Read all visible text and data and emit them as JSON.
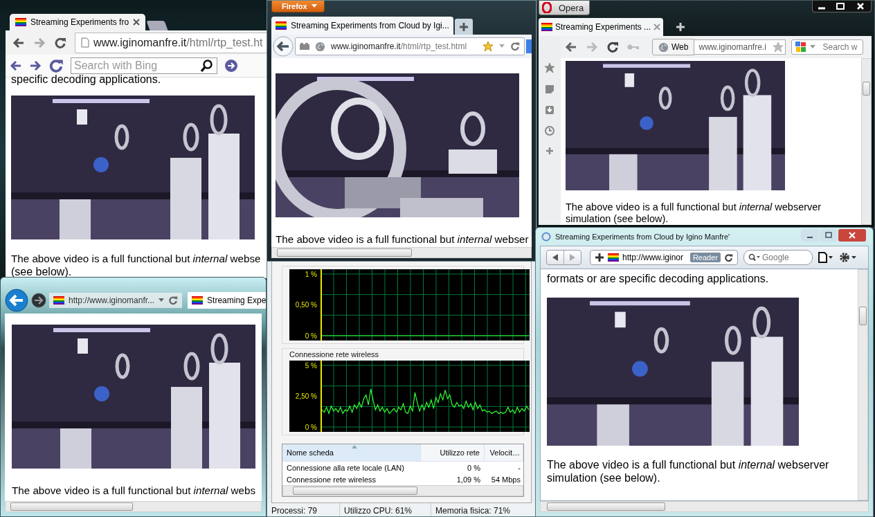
{
  "chrome_window": {
    "tab": {
      "title": "Streaming Experiments fro",
      "selected": true
    },
    "url": {
      "host": "www.iginomanfre.it",
      "path": "/html/rtp_test.ht"
    },
    "search": {
      "placeholder": "Search with Bing"
    },
    "page": {
      "intro": "specific decoding applications.",
      "caption": "The above video is a full functional but *internal* webse",
      "note": "(see below)."
    }
  },
  "firefox_window": {
    "menu_button": "Firefox",
    "tab": {
      "title": "Streaming Experiments from Cloud by Igi...",
      "selected": true
    },
    "url": {
      "host": "www.iginomanfre.it",
      "path": "/html/rtp_test.html"
    },
    "bookmarked": true,
    "page": {
      "caption": "The above video is a full functional but *internal* webser"
    }
  },
  "opera_window": {
    "menu_button": "Opera",
    "tab": {
      "title": "Streaming Experiments ...",
      "selected": true
    },
    "search_engine": "Web",
    "url": "www.iginomanfre.i",
    "search": {
      "placeholder": "Search w"
    },
    "page": {
      "caption": "The above video is a full functional but *internal* webserver simulation (see below)."
    }
  },
  "ie_window": {
    "url": "http://www.iginomanfr...",
    "tab": {
      "title": "Streaming Expe",
      "selected": true
    },
    "page": {
      "caption": "The above video is a full functional but *internal* webs"
    }
  },
  "safari_window": {
    "title": "Streaming Experiments from Cloud by Igino Manfre'",
    "url": "http://www.iginor",
    "reader_badge": "Reader",
    "search": {
      "placeholder": "Google"
    },
    "page": {
      "intro": "formats or are specific decoding applications.",
      "caption": "The above video is a full functional but *internal* webserver simulation (see below)."
    }
  },
  "task_manager": {
    "graphs": [
      {
        "chart_data": {
          "type": "line",
          "grid": true,
          "ylim": [
            0,
            1
          ],
          "yticks": [
            {
              "value": 0,
              "label": "0 %"
            },
            {
              "value": 0.5,
              "label": "0,50 %"
            },
            {
              "value": 1,
              "label": "1 %"
            }
          ],
          "series": [
            {
              "color": "#33ff33",
              "values": [
                0,
                0,
                0,
                0,
                0,
                0,
                0,
                0,
                0,
                0,
                0,
                0,
                0,
                0,
                0,
                0,
                0,
                0,
                0,
                0,
                0,
                0,
                0,
                0,
                0,
                0,
                0,
                0,
                0,
                0
              ]
            }
          ]
        }
      },
      {
        "chart_data": {
          "type": "line",
          "grid": true,
          "title": "Connessione rete wireless",
          "ylim": [
            0,
            5
          ],
          "yticks": [
            {
              "value": 0,
              "label": "0 %"
            },
            {
              "value": 2.5,
              "label": "2,50 %"
            },
            {
              "value": 5,
              "label": "5 %"
            }
          ],
          "series": [
            {
              "color": "#33ff33",
              "values": [
                1.4,
                1.2,
                1.6,
                1.1,
                1.7,
                1.3,
                1.5,
                1.2,
                1.6,
                1.1,
                1.4,
                1.3,
                1.7,
                1.2,
                1.8,
                1.5,
                2.0,
                1.6,
                2.3,
                2.6,
                1.8,
                3.1,
                2.2,
                1.4,
                1.8,
                1.3,
                1.6,
                1.2,
                1.5,
                1.1,
                1.3,
                1.5,
                1.2,
                1.6,
                1.4,
                1.9,
                1.2,
                1.1,
                1.7,
                1.3,
                2.8,
                2.0,
                1.3,
                1.8,
                1.4,
                2.0,
                1.6,
                2.2,
                1.5,
                2.4,
                2.0,
                2.7,
                2.2,
                3.0,
                2.3,
                2.6,
                1.8,
                1.6,
                2.0,
                1.7,
                1.8,
                1.5,
                2.1,
                1.6,
                1.9,
                1.4,
                2.0,
                1.5,
                1.8,
                1.3,
                1.4,
                1.2,
                1.3,
                1.1,
                1.2,
                1.3,
                1.1,
                1.2,
                1.1,
                1.2,
                1.6,
                1.2,
                1.4,
                1.1,
                1.6,
                1.2,
                1.5,
                1.3,
                1.7,
                1.4
              ]
            }
          ]
        }
      }
    ],
    "table": {
      "columns": [
        {
          "label": "Nome scheda",
          "sorted": true
        },
        {
          "label": "Utilizzo rete",
          "sorted": false
        },
        {
          "label": "Velocit…",
          "sorted": false
        }
      ],
      "rows": [
        [
          "Connessione alla rete locale (LAN)",
          "0 %",
          "-"
        ],
        [
          "Connessione rete wireless",
          "1,09 %",
          "54 Mbps"
        ]
      ]
    },
    "status_bar": [
      "Processi: 79",
      "Utilizzo CPU: 61%",
      "Memoria fisica: 71%"
    ]
  }
}
